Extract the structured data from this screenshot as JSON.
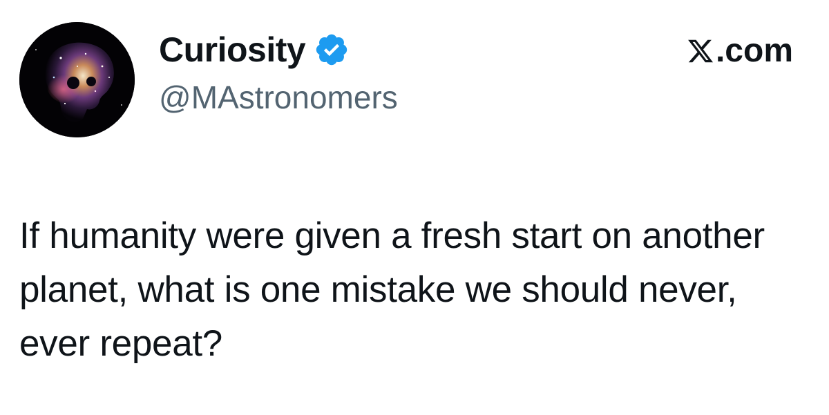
{
  "author": {
    "display_name": "Curiosity",
    "handle": "@MAstronomers",
    "verified": true,
    "verified_badge_icon": "verified-badge-icon",
    "verified_color": "#1d9bf0",
    "avatar_icon": "cosmic-skull-avatar"
  },
  "source": {
    "label": ".com",
    "logo_icon": "x-logo-icon"
  },
  "tweet": {
    "text": "If humanity were given a fresh start on another planet, what is one mistake we should never, ever repeat?"
  },
  "colors": {
    "text": "#0f1419",
    "secondary_text": "#536471",
    "background": "#ffffff"
  }
}
